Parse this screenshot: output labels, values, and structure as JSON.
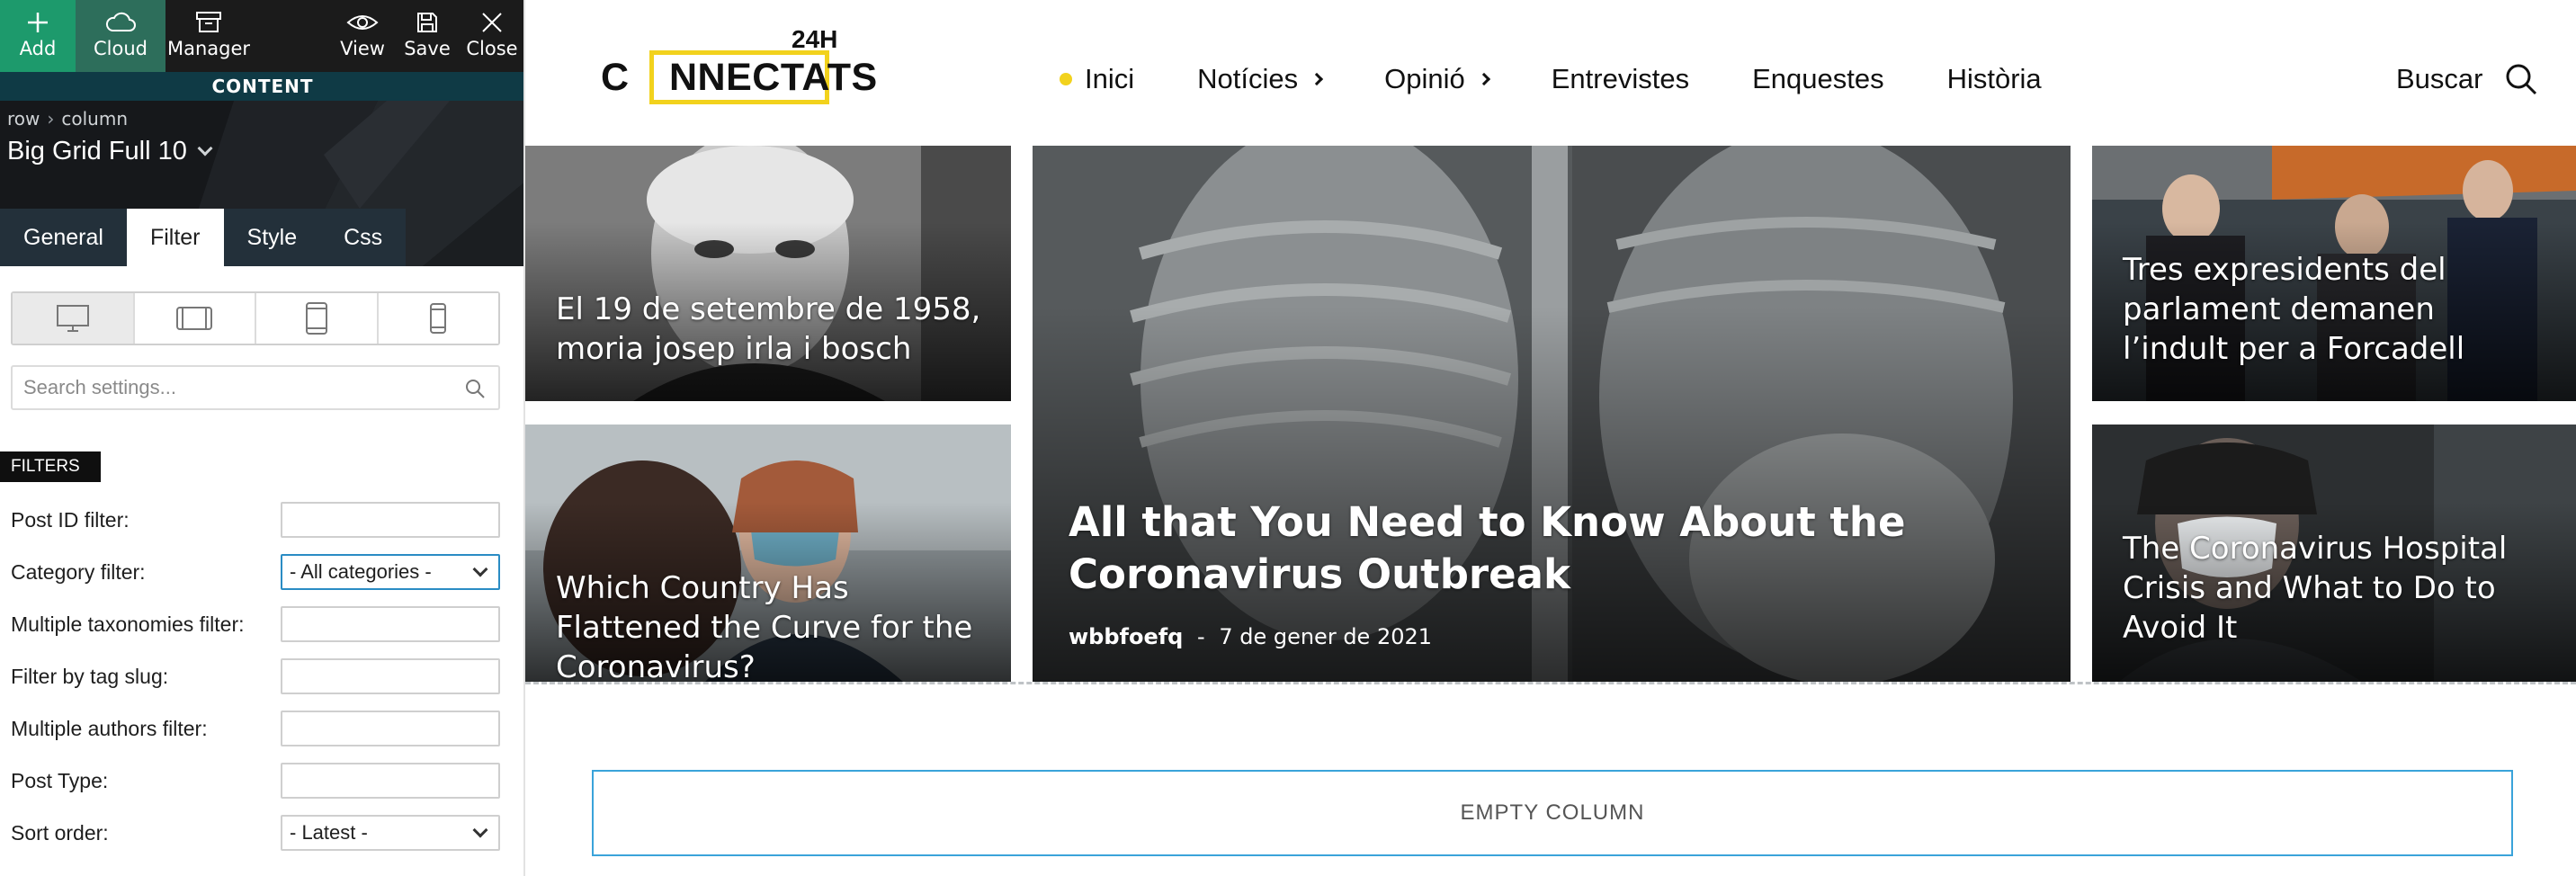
{
  "toolbar": {
    "add": "Add",
    "cloud": "Cloud",
    "manager": "Manager",
    "view": "View",
    "save": "Save",
    "close": "Close"
  },
  "panel": {
    "section_label": "CONTENT",
    "breadcrumb": [
      "row",
      "column"
    ],
    "module_title": "Big Grid Full 10",
    "tabs": [
      {
        "label": "General"
      },
      {
        "label": "Filter",
        "active": true
      },
      {
        "label": "Style"
      },
      {
        "label": "Css"
      }
    ],
    "devices": [
      "desktop-icon",
      "tablet-landscape-icon",
      "tablet-portrait-icon",
      "phone-icon"
    ],
    "search": {
      "placeholder": "Search settings..."
    },
    "filters_label": "FILTERS",
    "filters": [
      {
        "label": "Post ID filter:",
        "value": ""
      },
      {
        "label": "Category filter:",
        "value": "- All categories -",
        "type": "select"
      },
      {
        "label": "Multiple taxonomies filter:",
        "value": ""
      },
      {
        "label": "Filter by tag slug:",
        "value": ""
      },
      {
        "label": "Multiple authors filter:",
        "value": ""
      },
      {
        "label": "Post Type:",
        "value": ""
      },
      {
        "label": "Sort order:",
        "value": "- Latest -",
        "type": "select"
      }
    ],
    "colors": {
      "toolbar_bg": "#1b1b1b",
      "toolbar_active": "#1d9a6c",
      "content_bar": "#0f3a45",
      "tab_bg": "#23303a"
    }
  },
  "site": {
    "logo": {
      "tag": "24H",
      "first": "C",
      "rest": "NNECTATS"
    },
    "nav": [
      {
        "label": "Inici",
        "active": true
      },
      {
        "label": "Notícies",
        "has_submenu": true
      },
      {
        "label": "Opinió",
        "has_submenu": true
      },
      {
        "label": "Entrevistes"
      },
      {
        "label": "Enquestes"
      },
      {
        "label": "Història"
      }
    ],
    "search_label": "Buscar",
    "accent": "#f2d21d",
    "cards": {
      "irla": {
        "title": "El 19 de setembre de 1958, moria josep irla i bosch"
      },
      "curve": {
        "title": "Which Country Has Flattened the Curve for the Coronavirus?"
      },
      "main": {
        "title": "All that You Need to Know About the Coronavirus Outbreak",
        "author": "wbbfoefq",
        "separator": "-",
        "date": "7 de gener de 2021"
      },
      "expresidents": {
        "title": "Tres expresidents del parlament demanen l’indult per a Forcadell"
      },
      "hospital": {
        "title": "The Coronavirus Hospital Crisis and What to Do to Avoid It"
      }
    },
    "empty_column": "EMPTY COLUMN"
  }
}
